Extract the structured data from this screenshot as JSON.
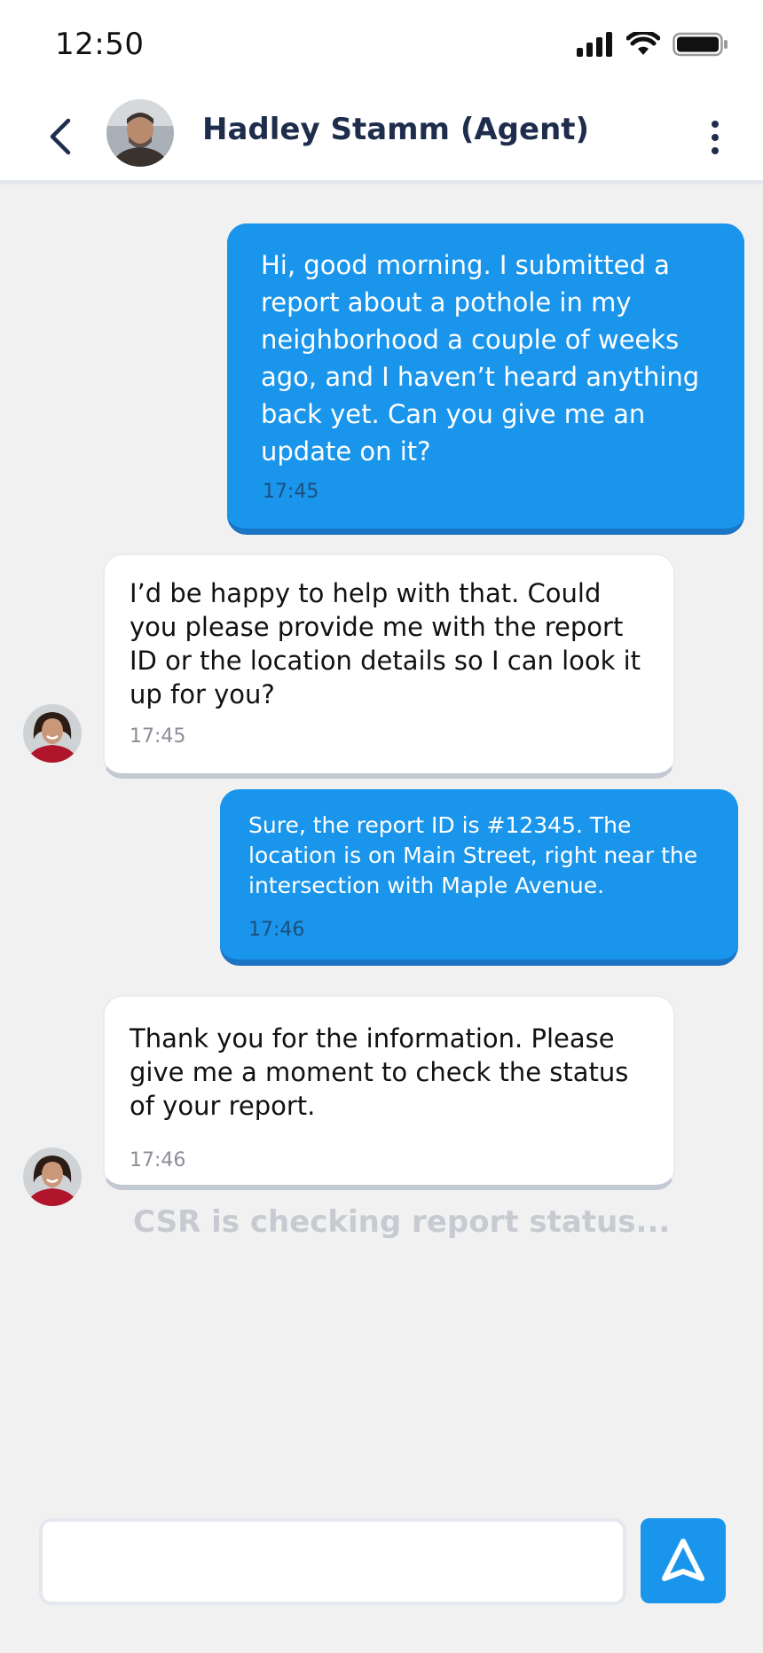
{
  "status_bar": {
    "time": "12:50"
  },
  "header": {
    "title": "Hadley Stamm (Agent)"
  },
  "messages": [
    {
      "sender": "user",
      "text": " Hi, good morning. I submitted a report about a pothole in my neighborhood a couple of weeks ago, and I haven’t heard anything back yet. Can you give me an update on it?",
      "time": "17:45"
    },
    {
      "sender": "agent",
      "text": "I’d be happy to help with that. Could you please provide me with the report ID or the location details so I can look it up for you?",
      "time": "17:45"
    },
    {
      "sender": "user",
      "text": "Sure, the report ID is #12345. The location is on Main Street, right near the intersection with Maple Avenue.",
      "time": "17:46"
    },
    {
      "sender": "agent",
      "text": "Thank you for the information. Please give me a moment to check the status of your report.",
      "time": "17:46"
    }
  ],
  "typing_indicator": "CSR is checking report status...",
  "composer": {
    "placeholder": ""
  },
  "colors": {
    "accent": "#1a95ec",
    "title": "#1f2d4d",
    "background": "#f1f1f2"
  },
  "icons": {
    "back": "chevron-left-icon",
    "menu": "more-vertical-icon",
    "send": "send-icon"
  }
}
